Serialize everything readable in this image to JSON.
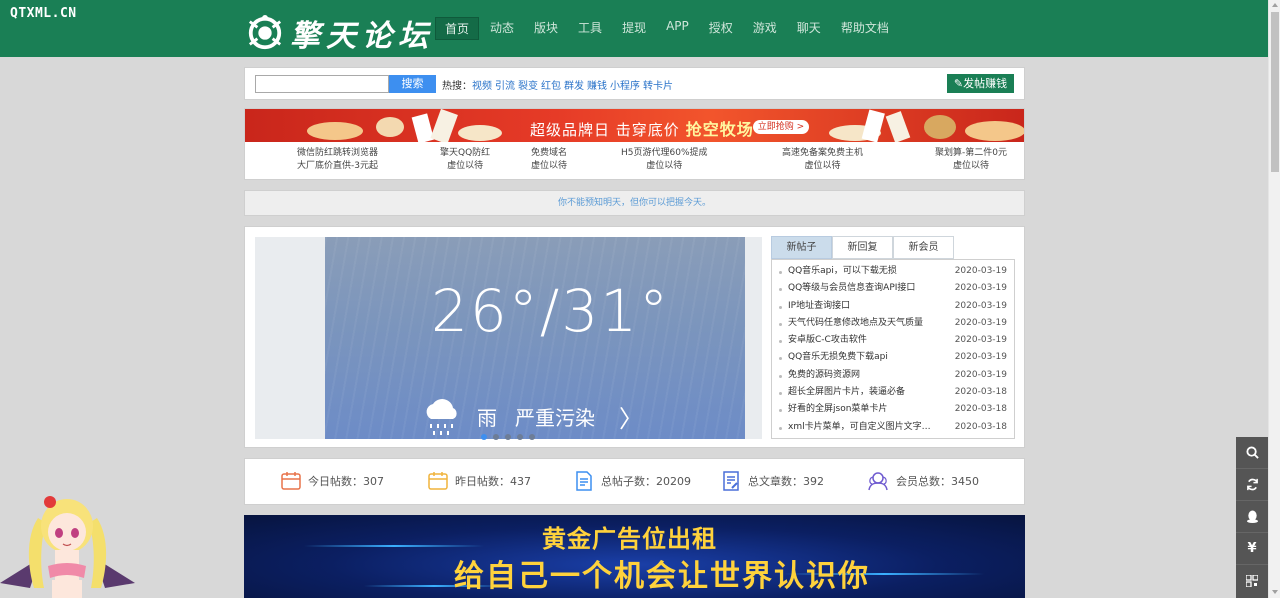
{
  "watermark": "QTXML.CN",
  "logo": {
    "text": "擎天论坛"
  },
  "nav": [
    "首页",
    "动态",
    "版块",
    "工具",
    "提现",
    "APP",
    "授权",
    "游戏",
    "聊天",
    "帮助文档"
  ],
  "search": {
    "button": "搜索",
    "hot_label": "热搜：",
    "hot_links": [
      "视频",
      "引流",
      "裂变",
      "红包",
      "群发",
      "赚钱",
      "小程序",
      "转卡片"
    ]
  },
  "post_button": "✎发帖赚钱",
  "banner": {
    "title": "超级品牌日 击穿底价",
    "highlight": "抢空牧场",
    "cta": "立即抢购 >"
  },
  "ad_links": [
    {
      "line1": "微信防红跳转浏览器",
      "line2": "大厂底价直供-3元起"
    },
    {
      "line1": "擎天QQ防红",
      "line2": "虚位以待"
    },
    {
      "line1": "免费域名",
      "line2": "虚位以待"
    },
    {
      "line1": "H5页游代理60%提成",
      "line2": "虚位以待"
    },
    {
      "line1": "高速免备案免费主机",
      "line2": "虚位以待"
    },
    {
      "line1": "聚划算-第二件0元",
      "line2": "虚位以待"
    }
  ],
  "motto": "你不能预知明天，但你可以把握今天。",
  "slide": {
    "temp": "26°/31°",
    "condition": "雨",
    "air": "严重污染",
    "arrow": "〉"
  },
  "tabs": [
    "新帖子",
    "新回复",
    "新会员"
  ],
  "posts": [
    {
      "title": "QQ音乐api，可以下载无损",
      "date": "2020-03-19"
    },
    {
      "title": "QQ等级与会员信息查询API接口",
      "date": "2020-03-19"
    },
    {
      "title": "IP地址查询接口",
      "date": "2020-03-19"
    },
    {
      "title": "天气代码任意修改地点及天气质量",
      "date": "2020-03-19"
    },
    {
      "title": "安卓版C-C攻击软件",
      "date": "2020-03-19"
    },
    {
      "title": "QQ音乐无损免费下载api",
      "date": "2020-03-19"
    },
    {
      "title": "免费的源码资源网",
      "date": "2020-03-19"
    },
    {
      "title": "超长全屏图片卡片，装逼必备",
      "date": "2020-03-18"
    },
    {
      "title": "好看的全屏json菜单卡片",
      "date": "2020-03-18"
    },
    {
      "title": "xml卡片菜单，可自定义图片文字…",
      "date": "2020-03-18"
    }
  ],
  "stats": [
    {
      "label": "今日帖数：307",
      "color": "#e8734a"
    },
    {
      "label": "昨日帖数：437",
      "color": "#f0b43c"
    },
    {
      "label": "总帖子数：20209",
      "color": "#3d8ff0"
    },
    {
      "label": "总文章数：392",
      "color": "#4a6fd8"
    },
    {
      "label": "会员总数：3450",
      "color": "#6f5bd0"
    }
  ],
  "ad_big": {
    "line1": "黄金广告位出租",
    "line2": "给自己一个机会让世界认识你"
  },
  "colors": {
    "brand": "#1a7f55",
    "link": "#2a73c9",
    "accent": "#3d8ff0"
  }
}
